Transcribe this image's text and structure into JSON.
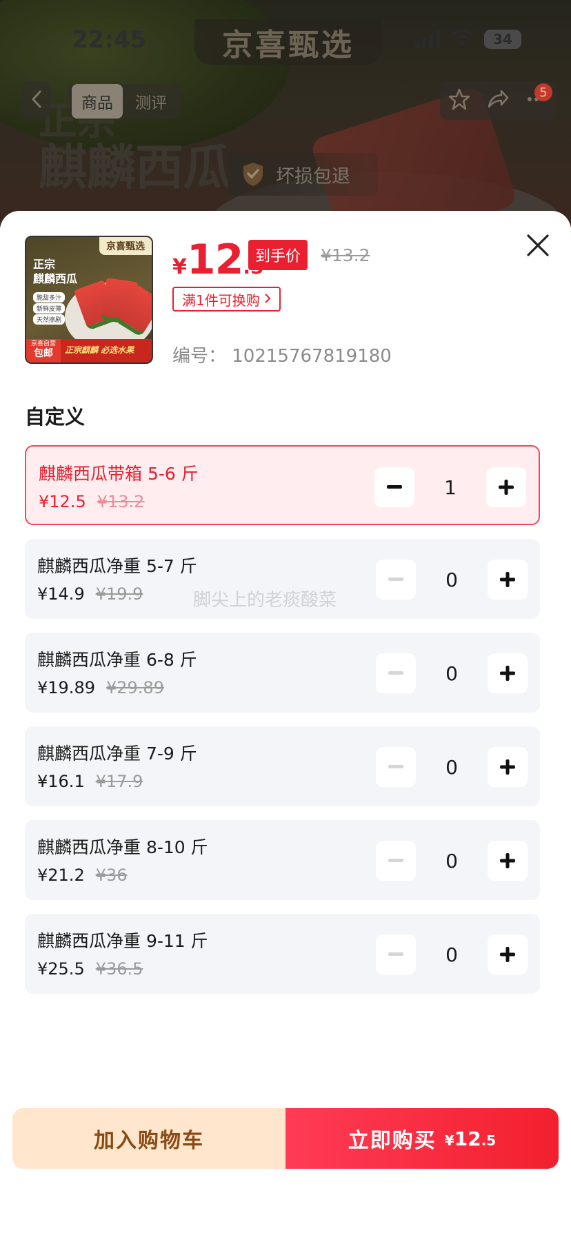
{
  "status_bar": {
    "time": "22:45",
    "battery": "34"
  },
  "brand_banner": "京喜甄选",
  "nav": {
    "tabs": [
      {
        "label": "商品"
      },
      {
        "label": "测评"
      }
    ],
    "message_badge": "5"
  },
  "hero": {
    "title_line1": "正宗",
    "title_line2": "麒麟西瓜",
    "guarantee": "坏损包退"
  },
  "thumbnail": {
    "brand": "京喜甄选",
    "title_line1": "正宗",
    "title_line2": "麒麟西瓜",
    "tags": [
      "脆甜多汁",
      "新鲜皮薄",
      "天然擦剧"
    ],
    "free_line1": "京喜自营",
    "free_line2": "包邮",
    "slogan": "正宗麒麟 必选水果"
  },
  "product": {
    "price_currency": "¥",
    "price_int": "12",
    "price_dec": ".5",
    "price_tag": "到手价",
    "original_price": "¥13.2",
    "promo": "满1件可换购",
    "sku_code": "编号： 10215767819180"
  },
  "section_title": "自定义",
  "options": [
    {
      "name": "麒麟西瓜带箱 5-6 斤",
      "price": "¥12.5",
      "original": "¥13.2",
      "qty": "1"
    },
    {
      "name": "麒麟西瓜净重 5-7 斤",
      "price": "¥14.9",
      "original": "¥19.9",
      "qty": "0"
    },
    {
      "name": "麒麟西瓜净重 6-8 斤",
      "price": "¥19.89",
      "original": "¥29.89",
      "qty": "0"
    },
    {
      "name": "麒麟西瓜净重 7-9 斤",
      "price": "¥16.1",
      "original": "¥17.9",
      "qty": "0"
    },
    {
      "name": "麒麟西瓜净重 8-10 斤",
      "price": "¥21.2",
      "original": "¥36",
      "qty": "0"
    },
    {
      "name": "麒麟西瓜净重 9-11 斤",
      "price": "¥25.5",
      "original": "¥36.5",
      "qty": "0"
    }
  ],
  "watermark": "脚尖上的老痰酸菜",
  "actions": {
    "add_to_cart": "加入购物车",
    "buy_now": "立即购买",
    "buy_currency": "¥",
    "buy_int": "12",
    "buy_dec": ".5"
  },
  "colors": {
    "accent": "#e8202f",
    "cart_bg": "#ffe6cc",
    "cart_text": "#8a4a16",
    "selected_bg": "#ffedef"
  },
  "icons": [
    "back-icon",
    "star-icon",
    "share-icon",
    "more-icon",
    "shield-check-icon",
    "close-icon",
    "minus-icon",
    "plus-icon",
    "chevron-right-icon"
  ]
}
